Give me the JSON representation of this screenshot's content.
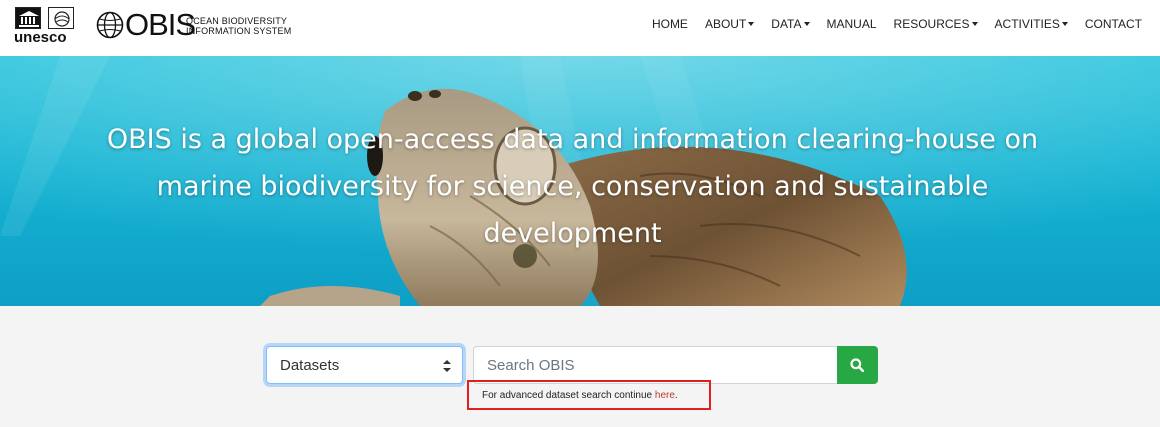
{
  "brand": {
    "unesco": "unesco",
    "obis": "OBIS",
    "obis_subtitle_line1": "OCEAN BIODIVERSITY",
    "obis_subtitle_line2": "INFORMATION SYSTEM"
  },
  "nav": {
    "items": [
      {
        "label": "HOME",
        "dropdown": false
      },
      {
        "label": "ABOUT",
        "dropdown": true
      },
      {
        "label": "DATA",
        "dropdown": true
      },
      {
        "label": "MANUAL",
        "dropdown": false
      },
      {
        "label": "RESOURCES",
        "dropdown": true
      },
      {
        "label": "ACTIVITIES",
        "dropdown": true
      },
      {
        "label": "CONTACT",
        "dropdown": false
      }
    ]
  },
  "hero": {
    "line1": "OBIS is a global open-access data and information clearing-house on",
    "line2": "marine biodiversity for science, conservation and sustainable",
    "line3": "development"
  },
  "search": {
    "select_value": "Datasets",
    "placeholder": "Search OBIS",
    "button_icon": "search-icon",
    "advanced_prefix": "For advanced dataset search continue ",
    "advanced_link": "here",
    "advanced_suffix": "."
  },
  "colors": {
    "search_button": "#28a745",
    "highlight_border": "#e0201c",
    "link": "#c0392b",
    "hero_water": "#15b4d3"
  }
}
